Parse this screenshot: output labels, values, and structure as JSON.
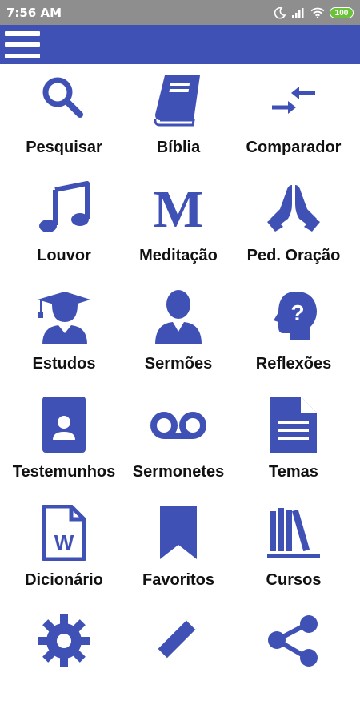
{
  "status": {
    "time": "7:56 AM",
    "battery": "100"
  },
  "colors": {
    "accent": "#3f51b5",
    "statusbar": "#8e8e8e"
  },
  "menu": [
    {
      "label": "Pesquisar",
      "icon": "search-icon"
    },
    {
      "label": "Bíblia",
      "icon": "book-icon"
    },
    {
      "label": "Comparador",
      "icon": "compare-arrows-icon"
    },
    {
      "label": "Louvor",
      "icon": "music-note-icon"
    },
    {
      "label": "Meditação",
      "icon": "letter-m-icon"
    },
    {
      "label": "Ped. Oração",
      "icon": "praying-hands-icon"
    },
    {
      "label": "Estudos",
      "icon": "graduate-icon"
    },
    {
      "label": "Sermões",
      "icon": "person-icon"
    },
    {
      "label": "Reflexões",
      "icon": "head-question-icon"
    },
    {
      "label": "Testemunhos",
      "icon": "contact-card-icon"
    },
    {
      "label": "Sermonetes",
      "icon": "voicemail-icon"
    },
    {
      "label": "Temas",
      "icon": "document-icon"
    },
    {
      "label": "Dicionário",
      "icon": "word-file-icon"
    },
    {
      "label": "Favoritos",
      "icon": "bookmark-icon"
    },
    {
      "label": "Cursos",
      "icon": "library-books-icon"
    },
    {
      "label": "",
      "icon": "gear-icon"
    },
    {
      "label": "",
      "icon": "pencil-icon"
    },
    {
      "label": "",
      "icon": "share-icon"
    }
  ]
}
